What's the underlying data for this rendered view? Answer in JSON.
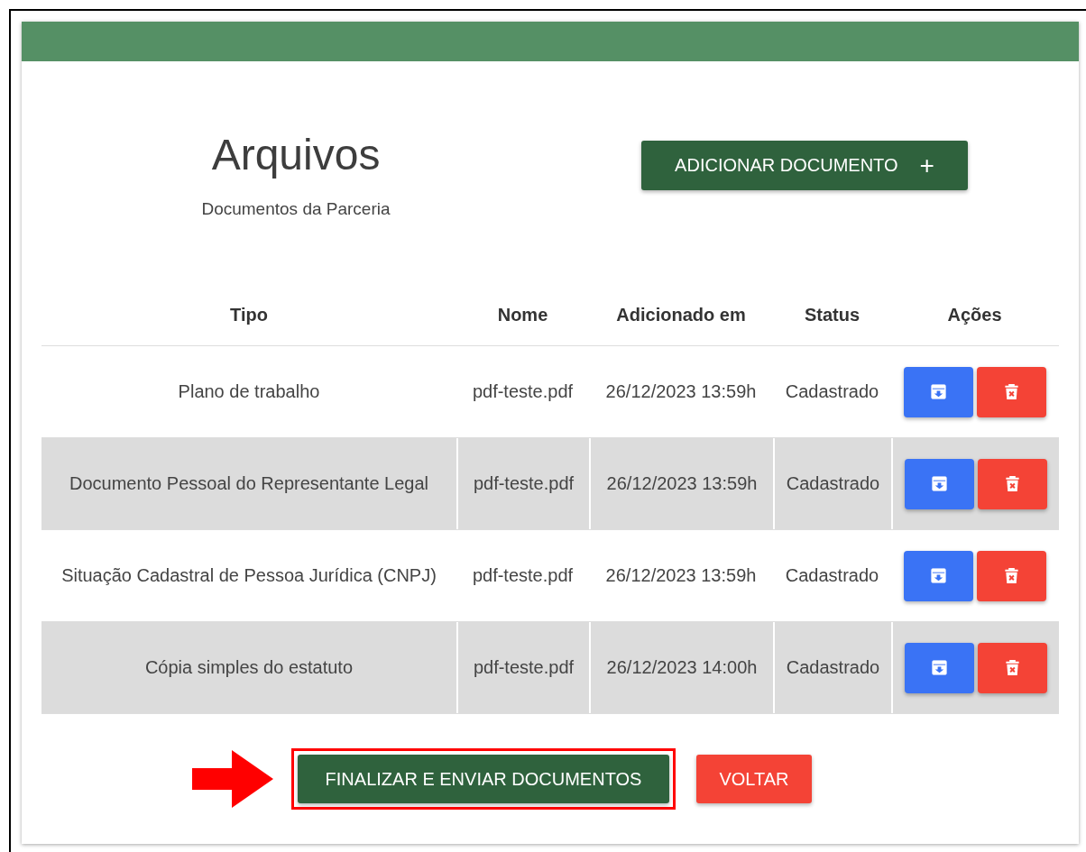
{
  "header": {
    "title": "Arquivos",
    "subtitle": "Documentos da Parceria",
    "add_button": {
      "label": "ADICIONAR DOCUMENTO",
      "icon": "+"
    }
  },
  "table": {
    "columns": [
      "Tipo",
      "Nome",
      "Adicionado em",
      "Status",
      "Ações"
    ],
    "rows": [
      {
        "tipo": "Plano de trabalho",
        "nome": "pdf-teste.pdf",
        "adicionado_em": "26/12/2023 13:59h",
        "status": "Cadastrado"
      },
      {
        "tipo": "Documento Pessoal do Representante Legal",
        "nome": "pdf-teste.pdf",
        "adicionado_em": "26/12/2023 13:59h",
        "status": "Cadastrado"
      },
      {
        "tipo": "Situação Cadastral de Pessoa Jurídica (CNPJ)",
        "nome": "pdf-teste.pdf",
        "adicionado_em": "26/12/2023 13:59h",
        "status": "Cadastrado"
      },
      {
        "tipo": "Cópia simples do estatuto",
        "nome": "pdf-teste.pdf",
        "adicionado_em": "26/12/2023 14:00h",
        "status": "Cadastrado"
      }
    ]
  },
  "buttons": [
    {
      "label": "FINALIZAR E ENVIAR DOCUMENTOS",
      "kind": "primary",
      "highlighted": true
    },
    {
      "label": "VOLTAR",
      "kind": "danger",
      "highlighted": false
    }
  ]
}
